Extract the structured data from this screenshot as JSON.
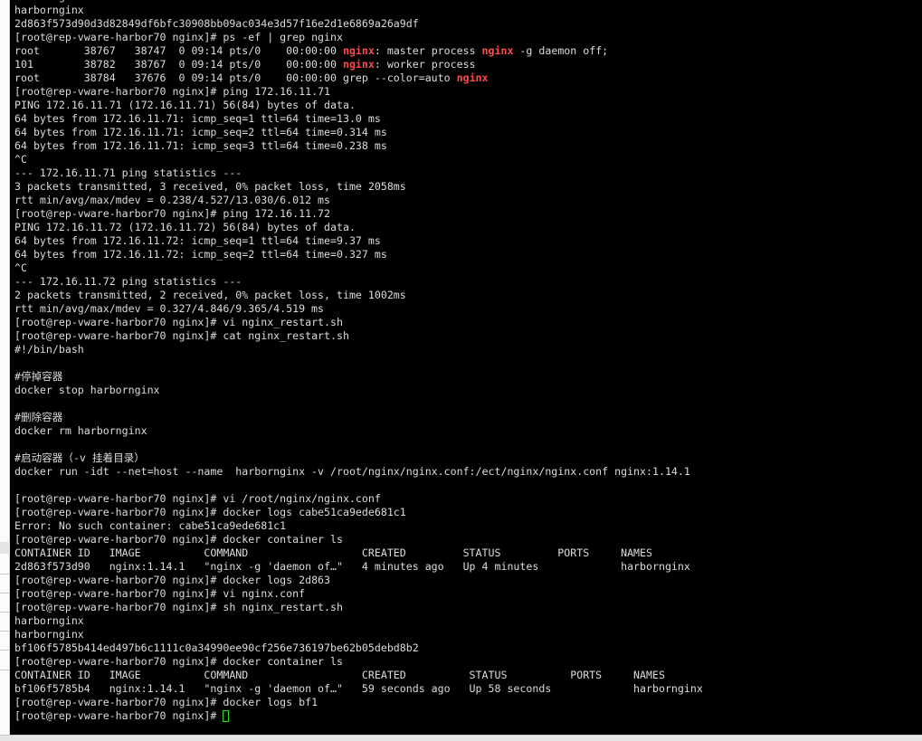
{
  "terminal": {
    "prompt": "[root@rep-vware-harbor70 nginx]# ",
    "colors": {
      "background": "#000000",
      "text": "#dcdcdc",
      "highlight": "#ff4a4a",
      "cursor": "#22dd22"
    },
    "lines": [
      {
        "text": "harbornginx"
      },
      {
        "text": "harbornginx"
      },
      {
        "text": "2d863f573d90d3d82849df6bfc30908bb09ac034e3d57f16e2d1e6869a26a9df"
      },
      {
        "prompt": true,
        "text": "ps -ef | grep nginx"
      },
      {
        "parts": [
          {
            "t": "root       38767   38747  0 09:14 pts/0    00:00:00 "
          },
          {
            "t": "nginx",
            "hl": true
          },
          {
            "t": ": master process "
          },
          {
            "t": "nginx",
            "hl": true
          },
          {
            "t": " -g daemon off;"
          }
        ]
      },
      {
        "parts": [
          {
            "t": "101        38782   38767  0 09:14 pts/0    00:00:00 "
          },
          {
            "t": "nginx",
            "hl": true
          },
          {
            "t": ": worker process"
          }
        ]
      },
      {
        "parts": [
          {
            "t": "root       38784   37676  0 09:14 pts/0    00:00:00 grep --color=auto "
          },
          {
            "t": "nginx",
            "hl": true
          }
        ]
      },
      {
        "prompt": true,
        "text": "ping 172.16.11.71"
      },
      {
        "text": "PING 172.16.11.71 (172.16.11.71) 56(84) bytes of data."
      },
      {
        "text": "64 bytes from 172.16.11.71: icmp_seq=1 ttl=64 time=13.0 ms"
      },
      {
        "text": "64 bytes from 172.16.11.71: icmp_seq=2 ttl=64 time=0.314 ms"
      },
      {
        "text": "64 bytes from 172.16.11.71: icmp_seq=3 ttl=64 time=0.238 ms"
      },
      {
        "text": "^C"
      },
      {
        "text": "--- 172.16.11.71 ping statistics ---"
      },
      {
        "text": "3 packets transmitted, 3 received, 0% packet loss, time 2058ms"
      },
      {
        "text": "rtt min/avg/max/mdev = 0.238/4.527/13.030/6.012 ms"
      },
      {
        "prompt": true,
        "text": "ping 172.16.11.72"
      },
      {
        "text": "PING 172.16.11.72 (172.16.11.72) 56(84) bytes of data."
      },
      {
        "text": "64 bytes from 172.16.11.72: icmp_seq=1 ttl=64 time=9.37 ms"
      },
      {
        "text": "64 bytes from 172.16.11.72: icmp_seq=2 ttl=64 time=0.327 ms"
      },
      {
        "text": "^C"
      },
      {
        "text": "--- 172.16.11.72 ping statistics ---"
      },
      {
        "text": "2 packets transmitted, 2 received, 0% packet loss, time 1002ms"
      },
      {
        "text": "rtt min/avg/max/mdev = 0.327/4.846/9.365/4.519 ms"
      },
      {
        "prompt": true,
        "text": "vi nginx_restart.sh"
      },
      {
        "prompt": true,
        "text": "cat nginx_restart.sh"
      },
      {
        "text": "#!/bin/bash"
      },
      {
        "text": ""
      },
      {
        "text": "#停掉容器"
      },
      {
        "text": "docker stop harbornginx"
      },
      {
        "text": ""
      },
      {
        "text": "#删除容器"
      },
      {
        "text": "docker rm harbornginx"
      },
      {
        "text": ""
      },
      {
        "text": "#启动容器（-v 挂着目录）"
      },
      {
        "text": "docker run -idt --net=host --name  harbornginx -v /root/nginx/nginx.conf:/ect/nginx/nginx.conf nginx:1.14.1"
      },
      {
        "text": ""
      },
      {
        "prompt": true,
        "text": "vi /root/nginx/nginx.conf"
      },
      {
        "prompt": true,
        "text": "docker logs cabe51ca9ede681c1"
      },
      {
        "text": "Error: No such container: cabe51ca9ede681c1"
      },
      {
        "prompt": true,
        "text": "docker container ls"
      },
      {
        "text": "CONTAINER ID   IMAGE          COMMAND                  CREATED         STATUS         PORTS     NAMES"
      },
      {
        "text": "2d863f573d90   nginx:1.14.1   \"nginx -g 'daemon of…\"   4 minutes ago   Up 4 minutes             harbornginx"
      },
      {
        "prompt": true,
        "text": "docker logs 2d863"
      },
      {
        "prompt": true,
        "text": "vi nginx.conf"
      },
      {
        "prompt": true,
        "text": "sh nginx_restart.sh"
      },
      {
        "text": "harbornginx"
      },
      {
        "text": "harbornginx"
      },
      {
        "text": "bf106f5785b414ed497b6c1111c0a34990ee90cf256e736197be62b05debd8b2"
      },
      {
        "prompt": true,
        "text": "docker container ls"
      },
      {
        "text": "CONTAINER ID   IMAGE          COMMAND                  CREATED          STATUS          PORTS     NAMES"
      },
      {
        "text": "bf106f5785b4   nginx:1.14.1   \"nginx -g 'daemon of…\"   59 seconds ago   Up 58 seconds             harbornginx"
      },
      {
        "prompt": true,
        "text": "docker logs bf1"
      },
      {
        "prompt": true,
        "text": "",
        "cursor": true
      }
    ]
  }
}
